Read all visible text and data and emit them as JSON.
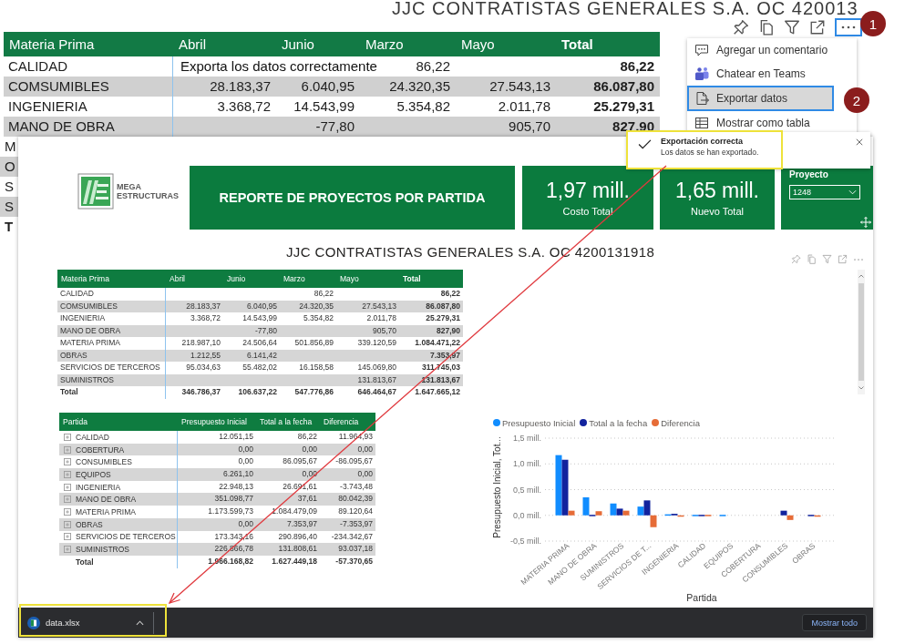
{
  "background_report": {
    "title": "JJC CONTRATISTAS GENERALES S.A. OC 420013",
    "toolbar": [
      {
        "kind": "pin",
        "selected": false
      },
      {
        "kind": "copy",
        "selected": false
      },
      {
        "kind": "filter",
        "selected": false
      },
      {
        "kind": "focus",
        "selected": false
      },
      {
        "kind": "more",
        "selected": true
      }
    ],
    "table": {
      "columns": [
        "Materia Prima",
        "Abril",
        "Junio",
        "Marzo",
        "Mayo",
        "Total"
      ],
      "rows": [
        {
          "kind": "data",
          "cells": [
            "CALIDAD",
            null,
            null,
            "86,22",
            null,
            "86,22"
          ]
        },
        {
          "kind": "data",
          "cells": [
            "COMSUMIBLES",
            "28.183,37",
            "6.040,95",
            "24.320,35",
            "27.543,13",
            "86.087,80"
          ]
        },
        {
          "kind": "data",
          "cells": [
            "INGENIERIA",
            "3.368,72",
            "14.543,99",
            "5.354,82",
            "2.011,78",
            "25.279,31"
          ]
        },
        {
          "kind": "data",
          "cells": [
            "MANO DE OBRA",
            null,
            "-77,80",
            null,
            "905,70",
            "827,90"
          ]
        }
      ],
      "cut_rows": [
        {
          "kind": "data",
          "label": "M"
        },
        {
          "kind": "data",
          "label": "O"
        },
        {
          "kind": "data",
          "label": "S"
        },
        {
          "kind": "data",
          "label": "S"
        },
        {
          "kind": "total",
          "label": "T"
        }
      ]
    },
    "context_menu": [
      {
        "kind": "comment",
        "label": "Agregar un comentario",
        "selected": false
      },
      {
        "kind": "people",
        "label": "Chatear en Teams",
        "selected": false
      },
      {
        "kind": "export",
        "label": "Exportar datos",
        "selected": true
      },
      {
        "kind": "table",
        "label": "Mostrar como tabla",
        "selected": false
      }
    ]
  },
  "annotations": {
    "note": "Exporta los datos correctamente",
    "steps": [
      "1",
      "2"
    ]
  },
  "report": {
    "logo": {
      "text": "MEGA ESTRUCTURAS"
    },
    "banner": "REPORTE DE PROYECTOS POR PARTIDA",
    "kpis": [
      {
        "value": "1,97 mill.",
        "label": "Costo Total"
      },
      {
        "value": "1,65 mill.",
        "label": "Nuevo Total"
      }
    ],
    "slicer": {
      "label": "Proyecto",
      "value": "1248"
    },
    "title": "JJC CONTRATISTAS GENERALES S.A. OC 4200131918",
    "visual_toolbar": [
      {
        "kind": "pin"
      },
      {
        "kind": "copy"
      },
      {
        "kind": "filter"
      },
      {
        "kind": "focus"
      },
      {
        "kind": "more"
      }
    ],
    "matrix": {
      "columns": [
        "Materia Prima",
        "Abril",
        "Junio",
        "Marzo",
        "Mayo",
        "Total"
      ],
      "rows": [
        {
          "kind": "data",
          "cells": [
            "CALIDAD",
            null,
            null,
            "86,22",
            null,
            "86,22"
          ]
        },
        {
          "kind": "data",
          "cells": [
            "COMSUMIBLES",
            "28.183,37",
            "6.040,95",
            "24.320,35",
            "27.543,13",
            "86.087,80"
          ]
        },
        {
          "kind": "data",
          "cells": [
            "INGENIERIA",
            "3.368,72",
            "14.543,99",
            "5.354,82",
            "2.011,78",
            "25.279,31"
          ]
        },
        {
          "kind": "data",
          "cells": [
            "MANO DE OBRA",
            null,
            "-77,80",
            null,
            "905,70",
            "827,90"
          ]
        },
        {
          "kind": "data",
          "cells": [
            "MATERIA PRIMA",
            "218.987,10",
            "24.506,64",
            "501.856,89",
            "339.120,59",
            "1.084.471,22"
          ]
        },
        {
          "kind": "data",
          "cells": [
            "OBRAS",
            "1.212,55",
            "6.141,42",
            null,
            null,
            "7.353,97"
          ]
        },
        {
          "kind": "data",
          "cells": [
            "SERVICIOS DE TERCEROS",
            "95.034,63",
            "55.482,02",
            "16.158,58",
            "145.069,80",
            "311.745,03"
          ]
        },
        {
          "kind": "data",
          "cells": [
            "SUMINISTROS",
            null,
            null,
            null,
            "131.813,67",
            "131.813,67"
          ]
        },
        {
          "kind": "total",
          "cells": [
            "Total",
            "346.786,37",
            "106.637,22",
            "547.776,86",
            "646.464,67",
            "1.647.665,12"
          ]
        }
      ]
    },
    "partida_table": {
      "columns": [
        "Partida",
        "Presupuesto Inicial",
        "Total a la fecha",
        "Diferencia"
      ],
      "rows": [
        {
          "kind": "data",
          "expanded": false,
          "cells": [
            "CALIDAD",
            "12.051,15",
            "86,22",
            "11.964,93"
          ]
        },
        {
          "kind": "data",
          "expanded": false,
          "cells": [
            "COBERTURA",
            "0,00",
            "0,00",
            "0,00"
          ]
        },
        {
          "kind": "data",
          "expanded": false,
          "cells": [
            "CONSUMIBLES",
            "0,00",
            "86.095,67",
            "-86.095,67"
          ]
        },
        {
          "kind": "data",
          "expanded": false,
          "cells": [
            "EQUIPOS",
            "6.261,10",
            "0,00",
            "0,00"
          ]
        },
        {
          "kind": "data",
          "expanded": false,
          "cells": [
            "INGENIERIA",
            "22.948,13",
            "26.691,61",
            "-3.743,48"
          ]
        },
        {
          "kind": "data",
          "expanded": false,
          "cells": [
            "MANO DE OBRA",
            "351.098,77",
            "37,61",
            "80.042,39"
          ]
        },
        {
          "kind": "data",
          "expanded": false,
          "cells": [
            "MATERIA PRIMA",
            "1.173.599,73",
            "1.084.479,09",
            "89.120,64"
          ]
        },
        {
          "kind": "data",
          "expanded": false,
          "cells": [
            "OBRAS",
            "0,00",
            "7.353,97",
            "-7.353,97"
          ]
        },
        {
          "kind": "data",
          "expanded": false,
          "cells": [
            "SERVICIOS DE TERCEROS",
            "173.343,16",
            "290.896,40",
            "-234.342,67"
          ]
        },
        {
          "kind": "data",
          "expanded": false,
          "cells": [
            "SUMINISTROS",
            "226.866,78",
            "131.808,61",
            "93.037,18"
          ]
        },
        {
          "kind": "total",
          "cells": [
            "Total",
            "1.966.168,82",
            "1.627.449,18",
            "-57.370,65"
          ]
        }
      ]
    },
    "chart_data": {
      "type": "bar",
      "xlabel": "Partida",
      "ylabel": "Presupuesto Inicial, Tot...",
      "categories": [
        "MATERIA PRIMA",
        "MANO DE OBRA",
        "SUMINISTROS",
        "SERVICIOS DE T...",
        "INGENIERIA",
        "CALIDAD",
        "EQUIPOS",
        "COBERTURA",
        "CONSUMIBLES",
        "OBRAS"
      ],
      "series": [
        {
          "name": "Presupuesto Inicial",
          "color": "#118dff",
          "values": [
            1.17,
            0.35,
            0.23,
            0.17,
            0.02,
            0.01,
            0.01,
            0,
            0,
            0
          ]
        },
        {
          "name": "Total a la fecha",
          "color": "#12239e",
          "values": [
            1.08,
            0.01,
            0.13,
            0.29,
            0.03,
            0.01,
            0,
            0,
            0.09,
            0.01
          ]
        },
        {
          "name": "Diferencia",
          "color": "#e66c37",
          "values": [
            0.09,
            0.08,
            0.09,
            -0.23,
            -0.01,
            0.01,
            0,
            0,
            -0.09,
            -0.01
          ]
        }
      ],
      "ylim": [
        -0.5,
        1.5
      ],
      "yticks": [
        {
          "value": -0.5,
          "label": "-0,5 mill."
        },
        {
          "value": 0,
          "label": "0,0 mill."
        },
        {
          "value": 0.5,
          "label": "0,5 mill."
        },
        {
          "value": 1,
          "label": "1,0 mill."
        },
        {
          "value": 1.5,
          "label": "1,5 mill."
        }
      ],
      "grid": true,
      "legend": true
    }
  },
  "toast": {
    "title": "Exportación correcta",
    "message": "Los datos se han exportado."
  },
  "download_bar": {
    "file": "data.xlsx",
    "button": "Mostrar todo"
  }
}
